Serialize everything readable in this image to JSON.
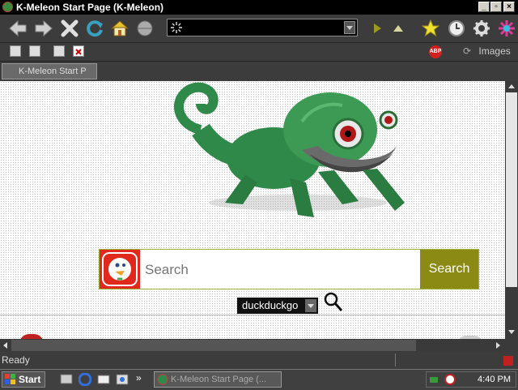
{
  "window": {
    "title": "K-Meleon Start Page (K-Meleon)"
  },
  "address_bar": {
    "value": "",
    "placeholder": ""
  },
  "toolbar2": {
    "images_label": "Images",
    "abp_label": "ABP"
  },
  "tabs": [
    {
      "label": "K-Meleon Start P"
    }
  ],
  "search": {
    "placeholder": "Search",
    "button_label": "Search",
    "engine": "duckduckgo"
  },
  "status": {
    "text": "Ready"
  },
  "taskbar": {
    "start_label": "Start",
    "task_label": "K-Meleon Start Page (...",
    "clock": "4:40 PM"
  },
  "colors": {
    "ddg_red": "#e0281c",
    "search_button": "#8a8a14",
    "chameleon_green": "#2f8a4a"
  },
  "icons": [
    "back-icon",
    "forward-icon",
    "stop-icon",
    "reload-icon",
    "home-icon",
    "globe-icon",
    "go-icon",
    "up-icon",
    "bookmark-star-icon",
    "history-clock-icon",
    "settings-gear-icon",
    "kmeleon-logo-icon",
    "search-magnifier-icon"
  ]
}
